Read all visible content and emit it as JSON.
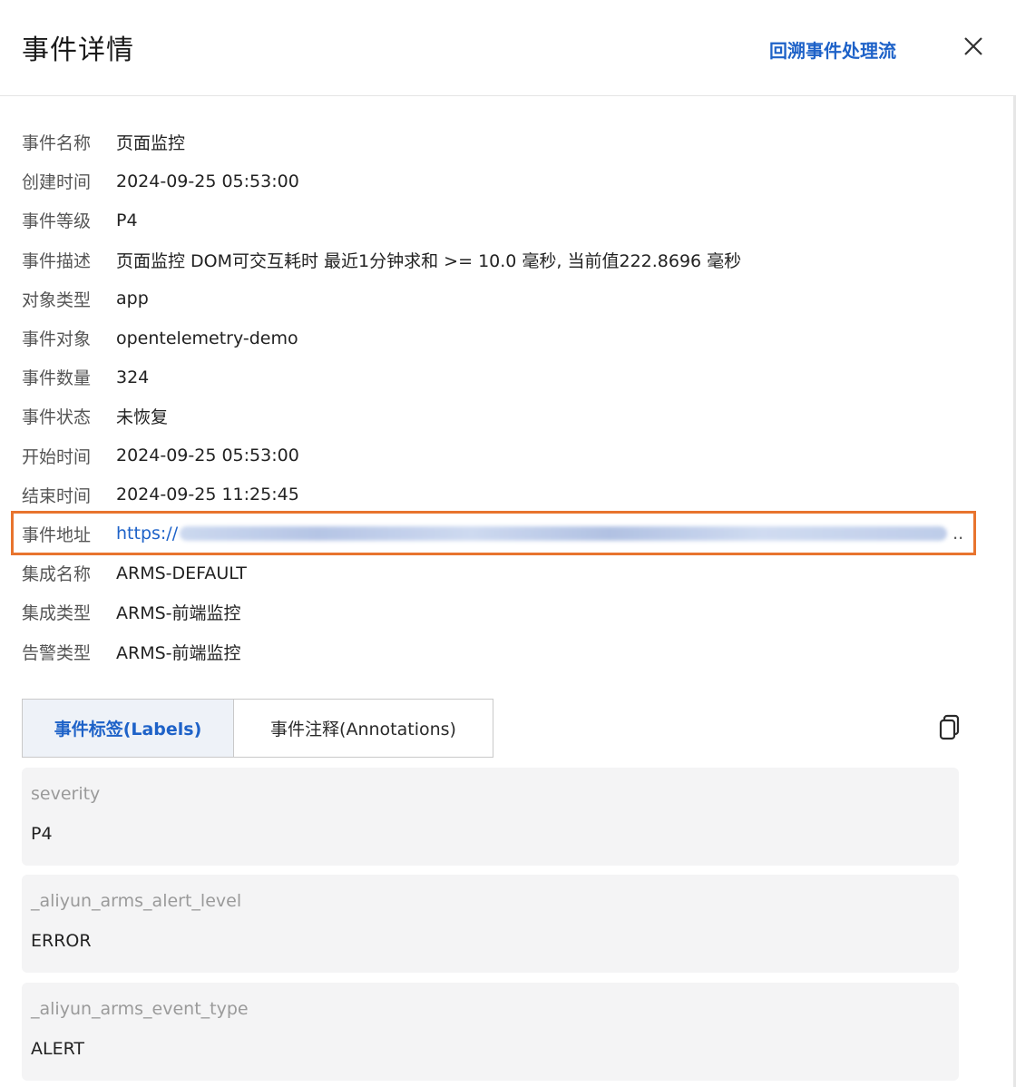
{
  "header": {
    "title": "事件详情",
    "trace_link": "回溯事件处理流",
    "close_icon": "close-icon"
  },
  "details": [
    {
      "label": "事件名称",
      "value": "页面监控"
    },
    {
      "label": "创建时间",
      "value": "2024-09-25 05:53:00"
    },
    {
      "label": "事件等级",
      "value": "P4"
    },
    {
      "label": "事件描述",
      "value": "页面监控 DOM可交互耗时 最近1分钟求和 >= 10.0 毫秒, 当前值222.8696 毫秒"
    },
    {
      "label": "对象类型",
      "value": "app"
    },
    {
      "label": "事件对象",
      "value": "opentelemetry-demo"
    },
    {
      "label": "事件数量",
      "value": "324"
    },
    {
      "label": "事件状态",
      "value": "未恢复"
    },
    {
      "label": "开始时间",
      "value": "2024-09-25 05:53:00"
    },
    {
      "label": "结束时间",
      "value": "2024-09-25 11:25:45"
    },
    {
      "label": "事件地址",
      "value": "https://",
      "suffix": ".."
    },
    {
      "label": "集成名称",
      "value": "ARMS-DEFAULT"
    },
    {
      "label": "集成类型",
      "value": "ARMS-前端监控"
    },
    {
      "label": "告警类型",
      "value": "ARMS-前端监控"
    }
  ],
  "tabs": [
    {
      "label": "事件标签(Labels)",
      "active": true
    },
    {
      "label": "事件注释(Annotations)",
      "active": false
    }
  ],
  "copy_icon": "copy-icon",
  "labels": [
    {
      "key": "severity",
      "value": "P4"
    },
    {
      "key": "_aliyun_arms_alert_level",
      "value": "ERROR"
    },
    {
      "key": "_aliyun_arms_event_type",
      "value": "ALERT"
    }
  ],
  "colors": {
    "accent": "#1e62c8",
    "highlight_border": "#e8742e",
    "card_background": "#f4f4f5"
  }
}
